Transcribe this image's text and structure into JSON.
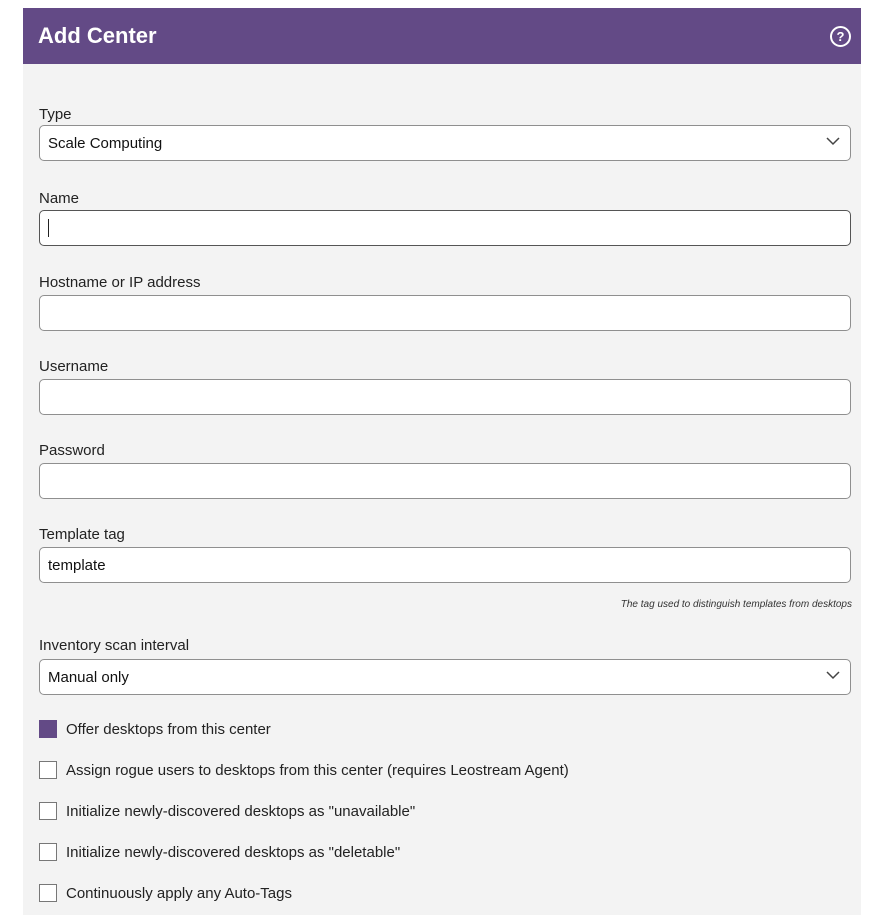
{
  "dialog": {
    "title": "Add Center",
    "help_icon": "help-circle-icon"
  },
  "form": {
    "type": {
      "label": "Type",
      "value": "Scale Computing"
    },
    "name": {
      "label": "Name",
      "value": ""
    },
    "hostname": {
      "label": "Hostname or IP address",
      "value": ""
    },
    "username": {
      "label": "Username",
      "value": ""
    },
    "password": {
      "label": "Password",
      "value": ""
    },
    "template_tag": {
      "label": "Template tag",
      "value": "template",
      "hint": "The tag used to distinguish templates from desktops"
    },
    "scan_interval": {
      "label": "Inventory scan interval",
      "value": "Manual only"
    }
  },
  "options": [
    {
      "label": "Offer desktops from this center",
      "checked": true
    },
    {
      "label": "Assign rogue users to desktops from this center (requires Leostream Agent)",
      "checked": false
    },
    {
      "label": "Initialize newly-discovered desktops as \"unavailable\"",
      "checked": false
    },
    {
      "label": "Initialize newly-discovered desktops as \"deletable\"",
      "checked": false
    },
    {
      "label": "Continuously apply any Auto-Tags",
      "checked": false
    }
  ],
  "colors": {
    "accent": "#634a86",
    "panel": "#f3f3f3"
  }
}
